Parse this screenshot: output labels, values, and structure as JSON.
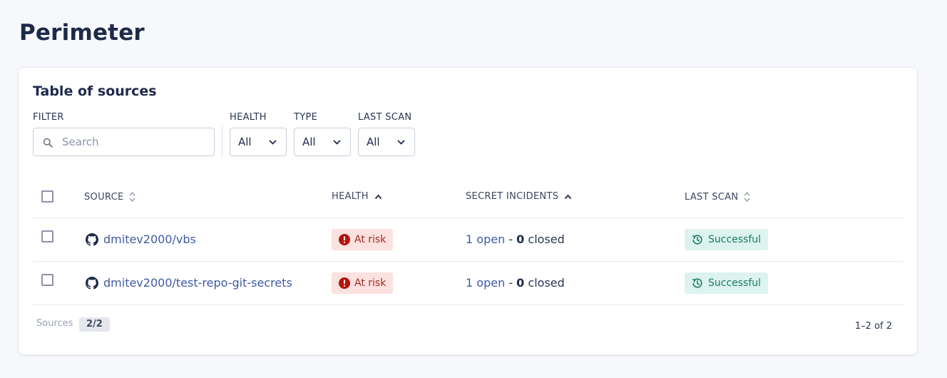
{
  "page": {
    "title": "Perimeter"
  },
  "card": {
    "title": "Table of sources"
  },
  "filters": {
    "filter_label": "FILTER",
    "search_placeholder": "Search",
    "health": {
      "label": "HEALTH",
      "value": "All"
    },
    "type": {
      "label": "TYPE",
      "value": "All"
    },
    "last_scan": {
      "label": "LAST SCAN",
      "value": "All"
    }
  },
  "table": {
    "columns": {
      "source": "SOURCE",
      "health": "HEALTH",
      "secret_incidents": "SECRET INCIDENTS",
      "last_scan": "LAST SCAN"
    },
    "rows": [
      {
        "source": "dmitev2000/vbs",
        "health": "At risk",
        "open_count": "1",
        "open_label": "open",
        "sep": " - ",
        "closed_count": "0",
        "closed_label": "closed",
        "last_scan": "Successful"
      },
      {
        "source": "dmitev2000/test-repo-git-secrets",
        "health": "At risk",
        "open_count": "1",
        "open_label": "open",
        "sep": " - ",
        "closed_count": "0",
        "closed_label": "closed",
        "last_scan": "Successful"
      }
    ]
  },
  "footer": {
    "sources_label": "Sources",
    "sources_count": "2/2",
    "pagination": "1–2 of 2"
  },
  "colors": {
    "risk_bg": "#fbe1df",
    "risk_fg": "#a32a22",
    "ok_bg": "#dcf3ee",
    "ok_fg": "#1b7b62",
    "link": "#3f5aa6"
  },
  "icons": {
    "search": "search-icon",
    "chevron": "chevron-down-icon",
    "sort": "sort-icon",
    "sort_asc": "sort-asc-icon",
    "github": "github-icon",
    "alert": "alert-circle-icon",
    "history": "history-icon"
  }
}
